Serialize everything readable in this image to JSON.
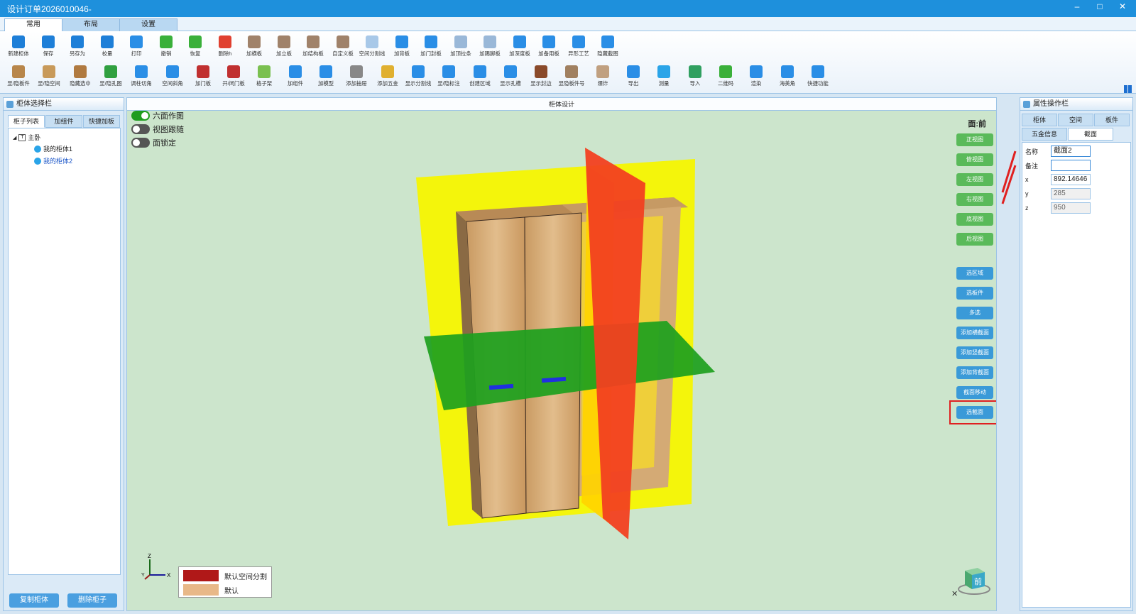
{
  "window": {
    "title": "设计订单2026010046-",
    "minimize": "–",
    "maximize": "□",
    "close": "✕"
  },
  "ribbon": {
    "tabs": [
      "常用",
      "布局",
      "设置"
    ]
  },
  "toolbar": {
    "row1": [
      {
        "label": "新建柜体",
        "color": "#1e7fd8"
      },
      {
        "label": "保存",
        "color": "#1e7fd8"
      },
      {
        "label": "另存为",
        "color": "#1e7fd8"
      },
      {
        "label": "校量",
        "color": "#1e7fd8"
      },
      {
        "label": "打印",
        "color": "#2a8ee6"
      },
      {
        "label": "撤销",
        "color": "#3ab03a"
      },
      {
        "label": "恢复",
        "color": "#3ab03a"
      },
      {
        "label": "删除h",
        "color": "#e04030"
      },
      {
        "label": "加横板",
        "color": "#a0826a"
      },
      {
        "label": "加立板",
        "color": "#a0826a"
      },
      {
        "label": "加结构板",
        "color": "#a0826a"
      },
      {
        "label": "自定义板",
        "color": "#a0826a"
      },
      {
        "label": "空间分割线",
        "color": "#a8c8e8"
      },
      {
        "label": "加背板",
        "color": "#2a8ee6"
      },
      {
        "label": "加门封板",
        "color": "#2a8ee6"
      },
      {
        "label": "加顶拉条",
        "color": "#9ab8d8"
      },
      {
        "label": "加踢脚板",
        "color": "#9ab8d8"
      },
      {
        "label": "加深度板",
        "color": "#2a8ee6"
      },
      {
        "label": "加备用板",
        "color": "#2a8ee6"
      },
      {
        "label": "异形工艺",
        "color": "#2a8ee6"
      },
      {
        "label": "隐藏截图",
        "color": "#2a8ee6"
      }
    ],
    "row2": [
      {
        "label": "显/隐板件",
        "color": "#b8864a"
      },
      {
        "label": "显/隐空间",
        "color": "#c89a5a"
      },
      {
        "label": "隐藏选中",
        "color": "#b07a40"
      },
      {
        "label": "显/隐孔图",
        "color": "#30a040"
      },
      {
        "label": "调柱切角",
        "color": "#2a8ee6"
      },
      {
        "label": "空间斜角",
        "color": "#2a8ee6"
      },
      {
        "label": "加门板",
        "color": "#c03030"
      },
      {
        "label": "开/闭门板",
        "color": "#c03030"
      },
      {
        "label": "格子架",
        "color": "#7ac050"
      },
      {
        "label": "加组件",
        "color": "#2a8ee6"
      },
      {
        "label": "加模型",
        "color": "#2a8ee6"
      },
      {
        "label": "添加抽屉",
        "color": "#888888"
      },
      {
        "label": "添加五金",
        "color": "#e0b030"
      },
      {
        "label": "显示分割线",
        "color": "#2a8ee6"
      },
      {
        "label": "显/隐标注",
        "color": "#2a8ee6"
      },
      {
        "label": "创建区域",
        "color": "#2a8ee6"
      },
      {
        "label": "显示孔槽",
        "color": "#2a8ee6"
      },
      {
        "label": "显示封边",
        "color": "#8a4a2a"
      },
      {
        "label": "显隐板件号",
        "color": "#a08060"
      },
      {
        "label": "爆炸",
        "color": "#c0a080"
      },
      {
        "label": "导出",
        "color": "#2a8ee6"
      },
      {
        "label": "测量",
        "color": "#2aa4e8"
      },
      {
        "label": "导入",
        "color": "#30a060"
      },
      {
        "label": "二维码",
        "color": "#3ab03a"
      },
      {
        "label": "渲染",
        "color": "#2a8ee6"
      },
      {
        "label": "海美角",
        "color": "#2a8ee6"
      },
      {
        "label": "快捷功能",
        "color": "#2a8ee6"
      }
    ]
  },
  "left_panel": {
    "title": "柜体选择栏",
    "tabs": [
      "柜子列表",
      "加组件",
      "快捷加板"
    ],
    "tree": {
      "root": "主卧",
      "items": [
        "我的柜体1",
        "我的柜体2"
      ]
    },
    "buttons": {
      "copy": "复制柜体",
      "delete": "删除柜子"
    }
  },
  "viewport": {
    "title": "柜体设计",
    "toggles": [
      {
        "label": "六面作图",
        "on": true
      },
      {
        "label": "视图跟随",
        "on": false
      },
      {
        "label": "面锁定",
        "on": false
      }
    ],
    "face": "面:前",
    "view_buttons": [
      "正视图",
      "俯视图",
      "左视图",
      "右视图",
      "底视图",
      "后视图"
    ],
    "action_buttons": [
      "选区域",
      "选板件",
      "多选",
      "添加横截面",
      "添加竖截面",
      "添加背截面",
      "截面移动",
      "选截面"
    ],
    "axis_labels": {
      "z": "Z",
      "x": "X",
      "y": "Y"
    },
    "legend": [
      {
        "label": "默认空间分割",
        "color": "#b01818"
      },
      {
        "label": "默认",
        "color": "#e8b888"
      }
    ],
    "cube_label": "前",
    "close": "✕"
  },
  "right_panel": {
    "title": "属性操作栏",
    "tabs_row1": [
      "柜体",
      "空间",
      "板件"
    ],
    "tabs_row2": [
      "五金信息",
      "截面"
    ],
    "props": {
      "name": {
        "label": "名称",
        "value": "截面2"
      },
      "note": {
        "label": "备注",
        "value": ""
      },
      "x": {
        "label": "x",
        "value": "892.14646"
      },
      "y": {
        "label": "y",
        "value": "285"
      },
      "z": {
        "label": "z",
        "value": "950"
      }
    }
  }
}
